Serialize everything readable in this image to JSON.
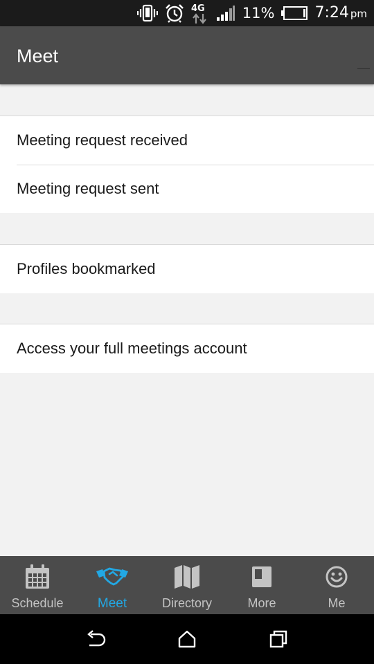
{
  "status_bar": {
    "network": "4G",
    "battery_percent": "11%",
    "time": "7:24",
    "ampm": "pm"
  },
  "app_bar": {
    "title": "Meet"
  },
  "menu": {
    "groups": [
      {
        "items": [
          "Meeting request received",
          "Meeting request sent"
        ]
      },
      {
        "items": [
          "Profiles bookmarked"
        ]
      },
      {
        "items": [
          "Access your full meetings account"
        ]
      }
    ]
  },
  "bottom_nav": {
    "active_color": "#22a8e4",
    "items": [
      {
        "label": "Schedule",
        "icon": "calendar-icon"
      },
      {
        "label": "Meet",
        "icon": "handshake-icon",
        "active": true
      },
      {
        "label": "Directory",
        "icon": "map-icon"
      },
      {
        "label": "More",
        "icon": "book-icon"
      },
      {
        "label": "Me",
        "icon": "smiley-icon"
      }
    ]
  },
  "system_nav": {
    "buttons": [
      "back-icon",
      "home-icon",
      "recents-icon"
    ]
  }
}
